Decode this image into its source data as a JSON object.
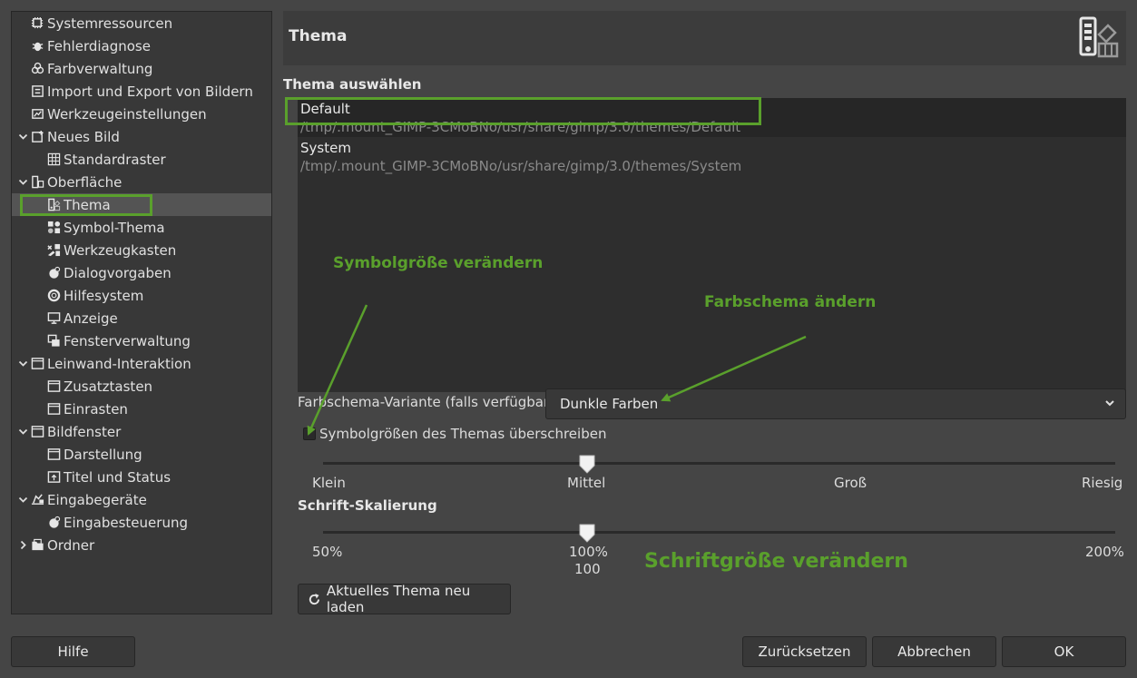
{
  "sidebar": {
    "items": [
      {
        "label": "Systemressourcen",
        "icon": "chip-icon",
        "level": 1,
        "expander": ""
      },
      {
        "label": "Fehlerdiagnose",
        "icon": "bug-icon",
        "level": 1,
        "expander": ""
      },
      {
        "label": "Farbverwaltung",
        "icon": "color-circles-icon",
        "level": 1,
        "expander": ""
      },
      {
        "label": "Import und Export von Bildern",
        "icon": "import-export-icon",
        "level": 1,
        "expander": ""
      },
      {
        "label": "Werkzeugeinstellungen",
        "icon": "tool-options-icon",
        "level": 1,
        "expander": ""
      },
      {
        "label": "Neues Bild",
        "icon": "new-image-icon",
        "level": 1,
        "expander": "open"
      },
      {
        "label": "Standardraster",
        "icon": "grid-icon",
        "level": 2,
        "expander": ""
      },
      {
        "label": "Oberfläche",
        "icon": "interface-icon",
        "level": 1,
        "expander": "open"
      },
      {
        "label": "Thema",
        "icon": "theme-icon",
        "level": 2,
        "expander": "",
        "selected": true
      },
      {
        "label": "Symbol-Thema",
        "icon": "icon-theme-icon",
        "level": 2,
        "expander": ""
      },
      {
        "label": "Werkzeugkasten",
        "icon": "toolbox-icon",
        "level": 2,
        "expander": ""
      },
      {
        "label": "Dialogvorgaben",
        "icon": "dialog-defaults-icon",
        "level": 2,
        "expander": ""
      },
      {
        "label": "Hilfesystem",
        "icon": "help-system-icon",
        "level": 2,
        "expander": ""
      },
      {
        "label": "Anzeige",
        "icon": "display-icon",
        "level": 2,
        "expander": ""
      },
      {
        "label": "Fensterverwaltung",
        "icon": "window-management-icon",
        "level": 2,
        "expander": ""
      },
      {
        "label": "Leinwand-Interaktion",
        "icon": "canvas-interaction-icon",
        "level": 1,
        "expander": "open"
      },
      {
        "label": "Zusatztasten",
        "icon": "modifiers-icon",
        "level": 2,
        "expander": ""
      },
      {
        "label": "Einrasten",
        "icon": "snapping-icon",
        "level": 2,
        "expander": ""
      },
      {
        "label": "Bildfenster",
        "icon": "image-window-icon",
        "level": 1,
        "expander": "open"
      },
      {
        "label": "Darstellung",
        "icon": "appearance-icon",
        "level": 2,
        "expander": ""
      },
      {
        "label": "Titel und Status",
        "icon": "title-status-icon",
        "level": 2,
        "expander": ""
      },
      {
        "label": "Eingabegeräte",
        "icon": "input-devices-icon",
        "level": 1,
        "expander": "open"
      },
      {
        "label": "Eingabesteuerung",
        "icon": "input-controllers-icon",
        "level": 2,
        "expander": ""
      },
      {
        "label": "Ordner",
        "icon": "folders-icon",
        "level": 1,
        "expander": "closed"
      }
    ]
  },
  "page": {
    "title": "Thema",
    "header_icon": "theme-icon"
  },
  "theme_select": {
    "title": "Thema auswählen",
    "themes": [
      {
        "name": "Default",
        "path": "/tmp/.mount_GIMP-3CMoBNo/usr/share/gimp/3.0/themes/Default",
        "selected": true
      },
      {
        "name": "System",
        "path": "/tmp/.mount_GIMP-3CMoBNo/usr/share/gimp/3.0/themes/System",
        "selected": false
      }
    ]
  },
  "color_scheme": {
    "label": "Farbschema-Variante (falls verfügbar)",
    "value": "Dunkle Farben"
  },
  "icon_size": {
    "checkbox_label": "Symbolgrößen des Themas überschreiben",
    "checked": false,
    "ticks": [
      "Klein",
      "Mittel",
      "Groß",
      "Riesig"
    ],
    "value_index": 1
  },
  "font_scale": {
    "title": "Schrift-Skalierung",
    "min_label": "50%",
    "mid_label": "100%",
    "max_label": "200%",
    "value": "100",
    "min": 50,
    "max": 200,
    "current": 100
  },
  "reload_button": {
    "label": "Aktuelles Thema neu laden",
    "icon": "reload-icon"
  },
  "buttons": {
    "help": "Hilfe",
    "reset": "Zurücksetzen",
    "cancel": "Abbrechen",
    "ok": "OK"
  },
  "annotations": {
    "icon_size": "Symbolgröße verändern",
    "color_scheme": "Farbschema ändern",
    "font_size": "Schriftgröße verändern",
    "color": "#5aa02c"
  }
}
